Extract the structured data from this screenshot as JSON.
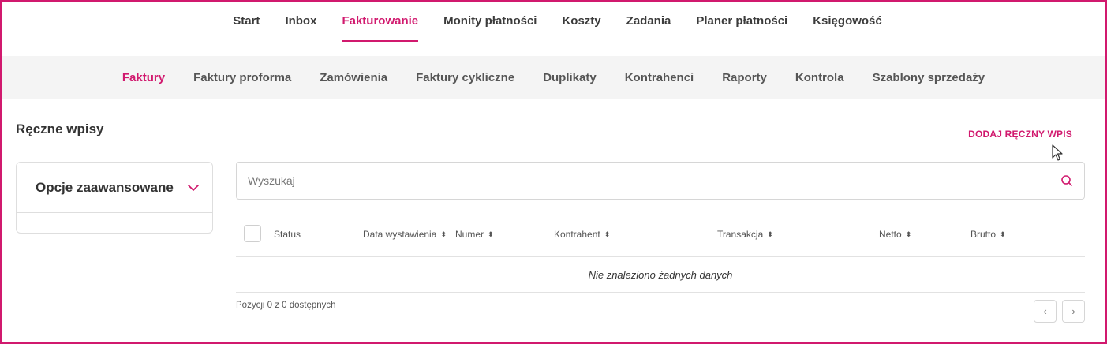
{
  "colors": {
    "accent": "#d1196e",
    "frame": "#d1196e",
    "subnav_bg": "#f4f4f4"
  },
  "top_nav": {
    "items": [
      {
        "label": "Start",
        "active": false
      },
      {
        "label": "Inbox",
        "active": false
      },
      {
        "label": "Fakturowanie",
        "active": true
      },
      {
        "label": "Monity płatności",
        "active": false
      },
      {
        "label": "Koszty",
        "active": false
      },
      {
        "label": "Zadania",
        "active": false
      },
      {
        "label": "Planer płatności",
        "active": false
      },
      {
        "label": "Księgowość",
        "active": false
      }
    ]
  },
  "sub_nav": {
    "items": [
      {
        "label": "Faktury",
        "active": true
      },
      {
        "label": "Faktury proforma",
        "active": false
      },
      {
        "label": "Zamówienia",
        "active": false
      },
      {
        "label": "Faktury cykliczne",
        "active": false
      },
      {
        "label": "Duplikaty",
        "active": false
      },
      {
        "label": "Kontrahenci",
        "active": false
      },
      {
        "label": "Raporty",
        "active": false
      },
      {
        "label": "Kontrola",
        "active": false
      },
      {
        "label": "Szablony sprzedaży",
        "active": false
      }
    ]
  },
  "page": {
    "title": "Ręczne wpisy",
    "add_button": "DODAJ RĘCZNY WPIS"
  },
  "advanced_options": {
    "title": "Opcje zaawansowane",
    "icon": "chevron-down-icon"
  },
  "search": {
    "placeholder": "Wyszukaj",
    "value": "",
    "icon": "search-icon"
  },
  "table": {
    "columns": {
      "status": "Status",
      "date": "Data wystawienia",
      "number": "Numer",
      "contractor": "Kontrahent",
      "transaction": "Transakcja",
      "net": "Netto",
      "gross": "Brutto"
    },
    "sort_icon": "⬍",
    "empty_text": "Nie znaleziono żadnych danych",
    "rows": []
  },
  "pagination": {
    "info": "Pozycji 0 z 0 dostępnych",
    "prev": "‹",
    "next": "›"
  }
}
